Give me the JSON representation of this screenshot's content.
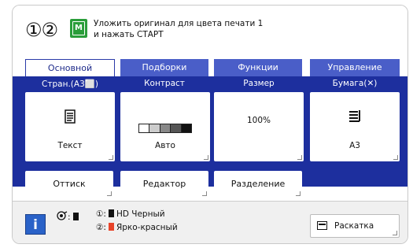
{
  "header": {
    "drum_indicators": "①②",
    "master_icon_letter": "M",
    "message_line1": "Уложить оригинал для цвета печати 1",
    "message_line2": "и нажать СТАРТ"
  },
  "tabs": [
    {
      "label": "Основной",
      "active": true
    },
    {
      "label": "Подборки",
      "active": false
    },
    {
      "label": "Функции",
      "active": false
    },
    {
      "label": "Управление",
      "active": false
    }
  ],
  "settings": [
    {
      "label": "Стран.(А3⬜)",
      "value": "Текст",
      "icon": "document-text-icon"
    },
    {
      "label": "Контраст",
      "value": "Авто",
      "icon": "contrast-scale-icon"
    },
    {
      "label": "Размер",
      "value": "100%",
      "icon": ""
    },
    {
      "label": "Бумага(✕)",
      "value": "А3",
      "icon": "paper-stack-icon"
    }
  ],
  "buttons": {
    "ottisk": "Оттиск",
    "editor": "Редактор",
    "separation": "Разделение"
  },
  "status": {
    "info_label": "i",
    "drum_label": ":",
    "ink1_index": "①:",
    "ink1_name": "HD Черный",
    "ink2_index": "②:",
    "ink2_name": "Ярко-красный",
    "raskatka": "Раскатка"
  },
  "colors": {
    "panel_blue": "#1d2f9e",
    "tab_blue": "#4a5ec8",
    "ink_black": "#111111",
    "ink_red": "#e8442a",
    "master_green": "#2a9d3a"
  }
}
